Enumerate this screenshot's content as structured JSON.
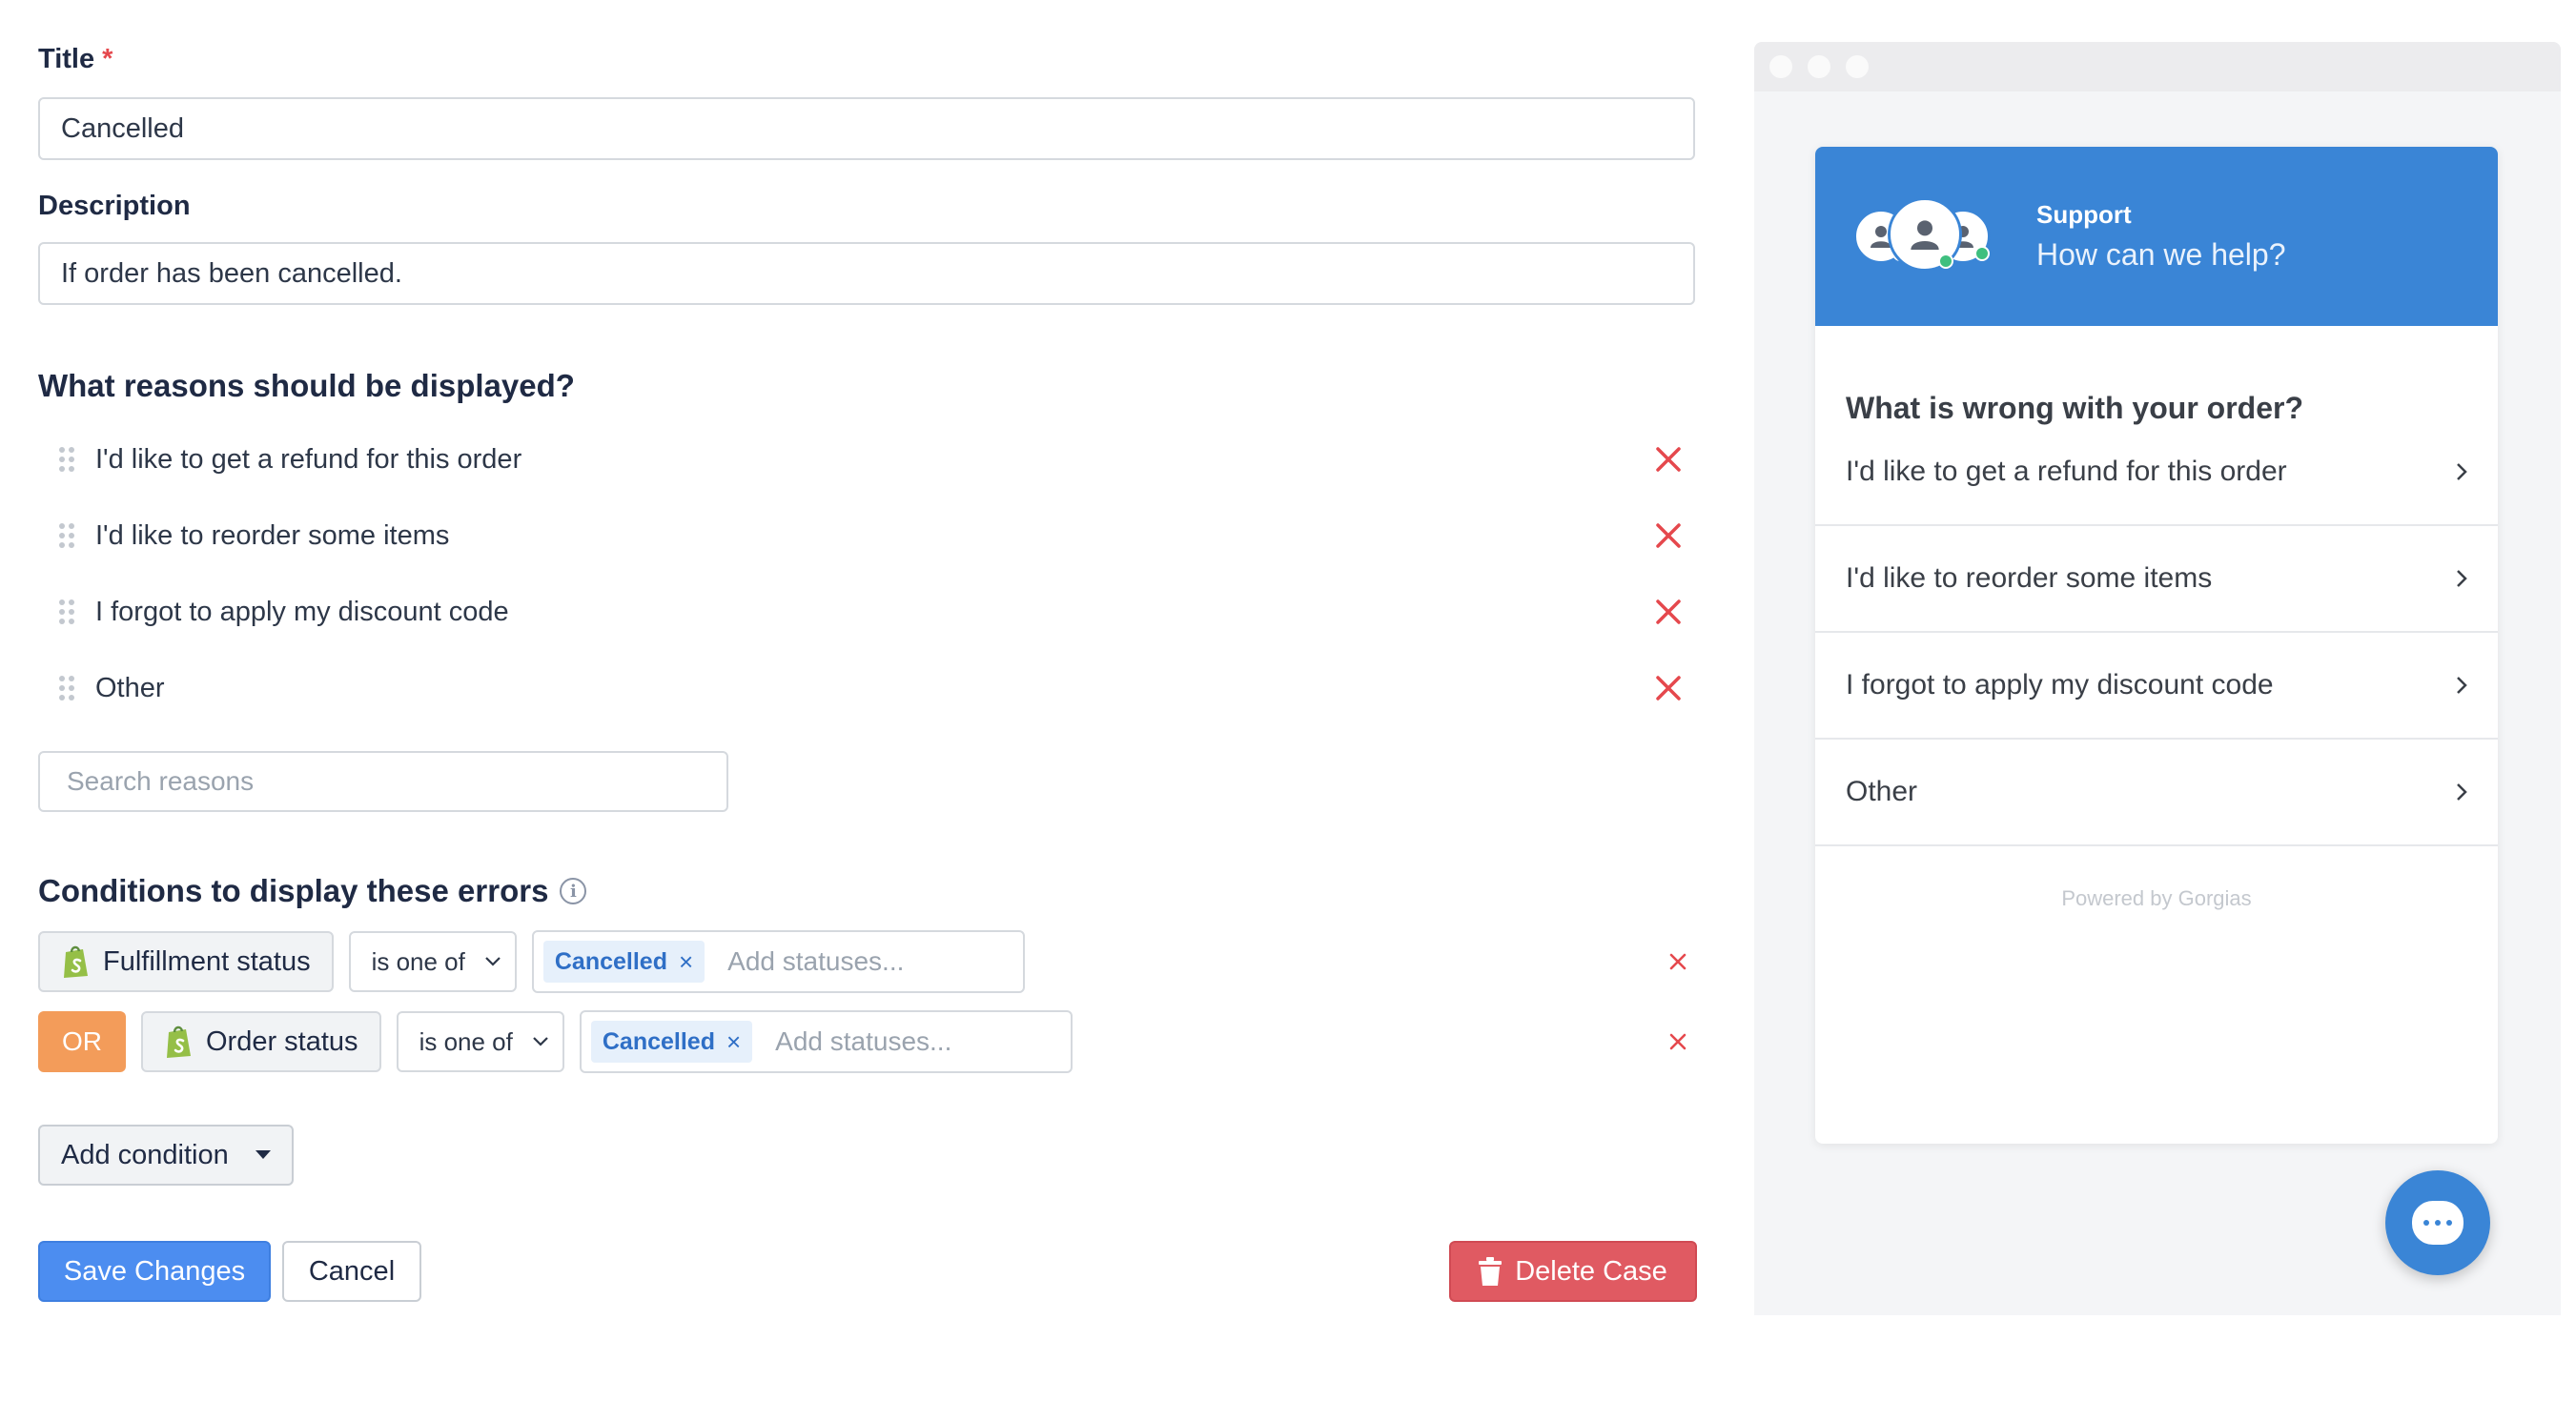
{
  "form": {
    "title_label": "Title",
    "required_mark": "*",
    "title_value": "Cancelled",
    "description_label": "Description",
    "description_value": "If order has been cancelled.",
    "reasons_heading": "What reasons should be displayed?",
    "reasons": [
      {
        "text": "I'd like to get a refund for this order"
      },
      {
        "text": "I'd like to reorder some items"
      },
      {
        "text": "I forgot to apply my discount code"
      },
      {
        "text": "Other"
      }
    ],
    "search_placeholder": "Search reasons",
    "conditions_heading": "Conditions to display these errors",
    "conditions": [
      {
        "field": "Fulfillment status",
        "operator": "is one of",
        "tag": "Cancelled",
        "placeholder": "Add statuses..."
      },
      {
        "connector": "OR",
        "field": "Order status",
        "operator": "is one of",
        "tag": "Cancelled",
        "placeholder": "Add statuses..."
      }
    ],
    "add_condition_label": "Add condition",
    "save_label": "Save Changes",
    "cancel_label": "Cancel",
    "delete_label": "Delete Case"
  },
  "preview": {
    "header_title": "Support",
    "header_subtitle": "How can we help?",
    "question": "What is wrong with your order?",
    "items": [
      "I'd like to get a refund for this order",
      "I'd like to reorder some items",
      "I forgot to apply my discount code",
      "Other"
    ],
    "powered_by": "Powered by Gorgias"
  },
  "colors": {
    "primary": "#4c8df0",
    "danger": "#e05a62",
    "or_badge": "#f39c5a",
    "widget_header": "#3a85d6",
    "tag_text": "#2f6fc6",
    "remove_icon": "#e5484d",
    "shopify_green": "#95bf47"
  },
  "icons": {
    "drag": "drag-handle-icon",
    "remove": "close-icon",
    "info": "info-icon",
    "shopify": "shopify-icon",
    "chevron": "chevron-right-icon",
    "trash": "trash-icon",
    "chat": "chat-icon"
  }
}
